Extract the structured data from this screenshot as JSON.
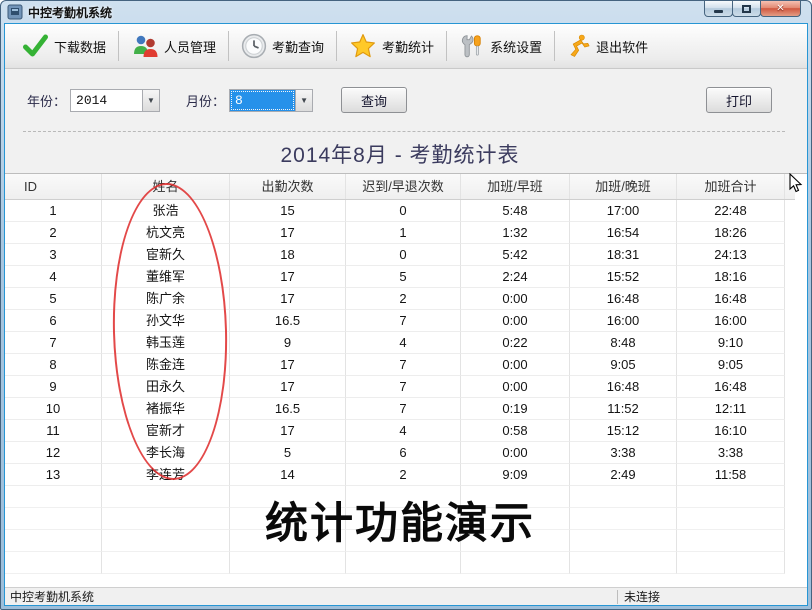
{
  "window": {
    "title": "中控考勤机系统"
  },
  "toolbar": {
    "items": [
      {
        "label": "下载数据",
        "icon": "check-icon"
      },
      {
        "label": "人员管理",
        "icon": "users-icon"
      },
      {
        "label": "考勤查询",
        "icon": "clock-icon"
      },
      {
        "label": "考勤统计",
        "icon": "star-icon"
      },
      {
        "label": "系统设置",
        "icon": "tools-icon"
      },
      {
        "label": "退出软件",
        "icon": "exit-runner-icon"
      }
    ]
  },
  "filters": {
    "year_label": "年份：",
    "year_value": "2014",
    "month_label": "月份：",
    "month_value": "8",
    "query_button": "查询",
    "print_button": "打印"
  },
  "report": {
    "title": "2014年8月 - 考勤统计表"
  },
  "table": {
    "headers": [
      "ID",
      "姓名",
      "出勤次数",
      "迟到/早退次数",
      "加班/早班",
      "加班/晚班",
      "加班合计"
    ],
    "rows": [
      [
        "1",
        "张浩",
        "15",
        "0",
        "5:48",
        "17:00",
        "22:48"
      ],
      [
        "2",
        "杭文亮",
        "17",
        "1",
        "1:32",
        "16:54",
        "18:26"
      ],
      [
        "3",
        "宦新久",
        "18",
        "0",
        "5:42",
        "18:31",
        "24:13"
      ],
      [
        "4",
        "董维军",
        "17",
        "5",
        "2:24",
        "15:52",
        "18:16"
      ],
      [
        "5",
        "陈广余",
        "17",
        "2",
        "0:00",
        "16:48",
        "16:48"
      ],
      [
        "6",
        "孙文华",
        "16.5",
        "7",
        "0:00",
        "16:00",
        "16:00"
      ],
      [
        "7",
        "韩玉莲",
        "9",
        "4",
        "0:22",
        "8:48",
        "9:10"
      ],
      [
        "8",
        "陈金连",
        "17",
        "7",
        "0:00",
        "9:05",
        "9:05"
      ],
      [
        "9",
        "田永久",
        "17",
        "7",
        "0:00",
        "16:48",
        "16:48"
      ],
      [
        "10",
        "褚振华",
        "16.5",
        "7",
        "0:19",
        "11:52",
        "12:11"
      ],
      [
        "11",
        "宦新才",
        "17",
        "4",
        "0:58",
        "15:12",
        "16:10"
      ],
      [
        "12",
        "李长海",
        "5",
        "6",
        "0:00",
        "3:38",
        "3:38"
      ],
      [
        "13",
        "李连芳",
        "14",
        "2",
        "9:09",
        "2:49",
        "11:58"
      ]
    ],
    "empty_row_count": 4
  },
  "annotation": {
    "ellipse_color": "#de2929"
  },
  "overlay": {
    "demo_text": "统计功能演示"
  },
  "statusbar": {
    "left": "中控考勤机系统",
    "right": "未连接"
  },
  "colors": {
    "month_highlight": "#2591ea",
    "title_text": "#3b3b5e",
    "frame_blue": "#a9c7e0"
  }
}
